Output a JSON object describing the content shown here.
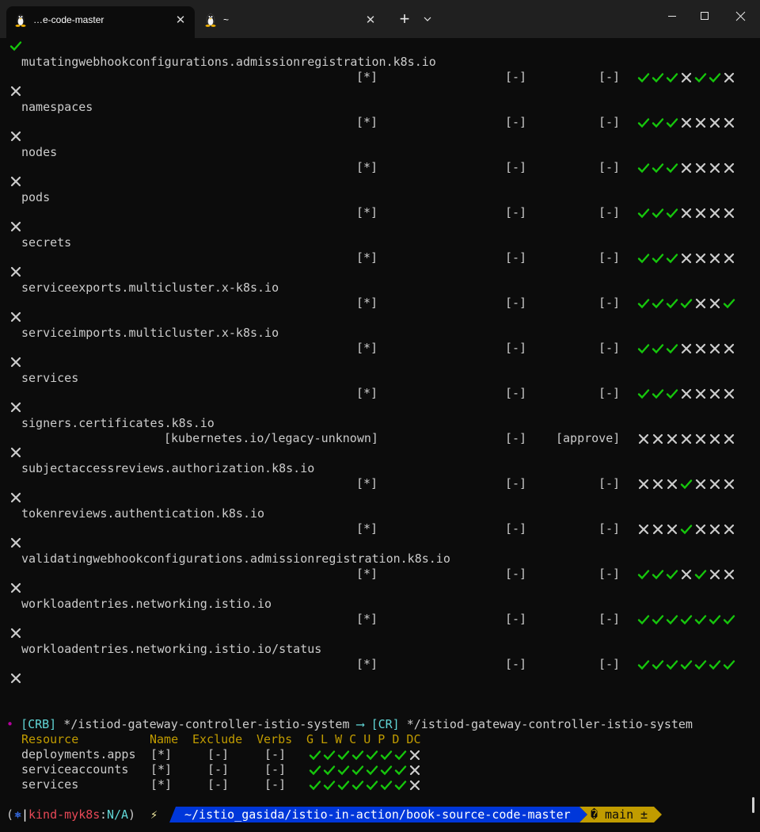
{
  "tabs": [
    {
      "title": "…e-code-master",
      "icon": "tux-icon",
      "active": true
    },
    {
      "title": "~",
      "icon": "tux-icon",
      "active": false
    }
  ],
  "tab_controls": {
    "new_tab": "+",
    "dropdown": "⌄"
  },
  "colors": {
    "check": "#16c60c",
    "cross": "#cccccc",
    "cyan": "#61d6d6",
    "yellow": "#c19c00",
    "magenta": "#b4009e",
    "prompt_path_bg": "#0037da",
    "prompt_git_bg": "#c19c00"
  },
  "top_status": "check",
  "resources": [
    {
      "name": "mutatingwebhookconfigurations.admissionregistration.k8s.io",
      "resource_name": "[*]",
      "exclude": "[-]",
      "verbs": "[-]",
      "marks": [
        1,
        1,
        1,
        0,
        1,
        1,
        0
      ],
      "status": "cross"
    },
    {
      "name": "namespaces",
      "resource_name": "[*]",
      "exclude": "[-]",
      "verbs": "[-]",
      "marks": [
        1,
        1,
        1,
        0,
        0,
        0,
        0
      ],
      "status": "cross"
    },
    {
      "name": "nodes",
      "resource_name": "[*]",
      "exclude": "[-]",
      "verbs": "[-]",
      "marks": [
        1,
        1,
        1,
        0,
        0,
        0,
        0
      ],
      "status": "cross"
    },
    {
      "name": "pods",
      "resource_name": "[*]",
      "exclude": "[-]",
      "verbs": "[-]",
      "marks": [
        1,
        1,
        1,
        0,
        0,
        0,
        0
      ],
      "status": "cross"
    },
    {
      "name": "secrets",
      "resource_name": "[*]",
      "exclude": "[-]",
      "verbs": "[-]",
      "marks": [
        1,
        1,
        1,
        0,
        0,
        0,
        0
      ],
      "status": "cross"
    },
    {
      "name": "serviceexports.multicluster.x-k8s.io",
      "resource_name": "[*]",
      "exclude": "[-]",
      "verbs": "[-]",
      "marks": [
        1,
        1,
        1,
        1,
        0,
        0,
        1
      ],
      "status": "cross"
    },
    {
      "name": "serviceimports.multicluster.x-k8s.io",
      "resource_name": "[*]",
      "exclude": "[-]",
      "verbs": "[-]",
      "marks": [
        1,
        1,
        1,
        0,
        0,
        0,
        0
      ],
      "status": "cross"
    },
    {
      "name": "services",
      "resource_name": "[*]",
      "exclude": "[-]",
      "verbs": "[-]",
      "marks": [
        1,
        1,
        1,
        0,
        0,
        0,
        0
      ],
      "status": "cross"
    },
    {
      "name": "signers.certificates.k8s.io",
      "resource_name": "[kubernetes.io/legacy-unknown]",
      "exclude": "[-]",
      "verbs": "[approve]",
      "marks": [
        0,
        0,
        0,
        0,
        0,
        0,
        0
      ],
      "status": "cross"
    },
    {
      "name": "subjectaccessreviews.authorization.k8s.io",
      "resource_name": "[*]",
      "exclude": "[-]",
      "verbs": "[-]",
      "marks": [
        0,
        0,
        0,
        1,
        0,
        0,
        0
      ],
      "status": "cross"
    },
    {
      "name": "tokenreviews.authentication.k8s.io",
      "resource_name": "[*]",
      "exclude": "[-]",
      "verbs": "[-]",
      "marks": [
        0,
        0,
        0,
        1,
        0,
        0,
        0
      ],
      "status": "cross"
    },
    {
      "name": "validatingwebhookconfigurations.admissionregistration.k8s.io",
      "resource_name": "[*]",
      "exclude": "[-]",
      "verbs": "[-]",
      "marks": [
        1,
        1,
        1,
        0,
        1,
        0,
        0
      ],
      "status": "cross"
    },
    {
      "name": "workloadentries.networking.istio.io",
      "resource_name": "[*]",
      "exclude": "[-]",
      "verbs": "[-]",
      "marks": [
        1,
        1,
        1,
        1,
        1,
        1,
        1
      ],
      "status": "cross"
    },
    {
      "name": "workloadentries.networking.istio.io/status",
      "resource_name": "[*]",
      "exclude": "[-]",
      "verbs": "[-]",
      "marks": [
        1,
        1,
        1,
        1,
        1,
        1,
        1
      ],
      "status": "cross"
    }
  ],
  "binding": {
    "bullet": "•",
    "crb_tag": "[CRB]",
    "crb_name": "*/istiod-gateway-controller-istio-system",
    "arrow": "⟶",
    "cr_tag": "[CR]",
    "cr_name": "*/istiod-gateway-controller-istio-system"
  },
  "summary_header": {
    "resource": "Resource",
    "name": "Name",
    "exclude": "Exclude",
    "verbs": "Verbs",
    "letters": "G L W C U P D DC"
  },
  "summary_rows": [
    {
      "resource": "deployments.apps",
      "name": "[*]",
      "exclude": "[-]",
      "verbs": "[-]",
      "marks": [
        1,
        1,
        1,
        1,
        1,
        1,
        1,
        0
      ]
    },
    {
      "resource": "serviceaccounts",
      "name": "[*]",
      "exclude": "[-]",
      "verbs": "[-]",
      "marks": [
        1,
        1,
        1,
        1,
        1,
        1,
        1,
        0
      ]
    },
    {
      "resource": "services",
      "name": "[*]",
      "exclude": "[-]",
      "verbs": "[-]",
      "marks": [
        1,
        1,
        1,
        1,
        1,
        1,
        1,
        0
      ]
    }
  ],
  "prompt": {
    "open_paren": "(",
    "k8s_glyph": "⎈",
    "separator": "|",
    "context": "kind-myk8s",
    "colon": ":",
    "namespace": "N/A",
    "close_paren": ")",
    "bolt": "⚡",
    "path": "~/istio_gasida/istio-in-action/book-source-code-master",
    "branch_glyph": "�",
    "branch": "main",
    "dirty": "±"
  }
}
